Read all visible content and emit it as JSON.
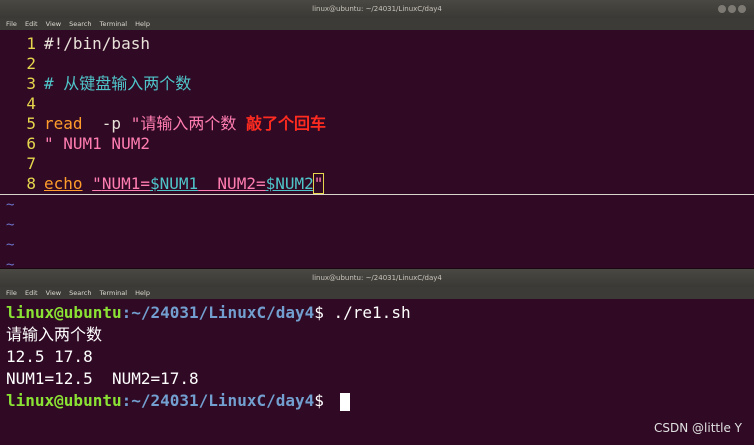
{
  "top": {
    "title": "linux@ubuntu: ~/24031/LinuxC/day4",
    "menu": [
      "File",
      "Edit",
      "View",
      "Search",
      "Terminal",
      "Help"
    ]
  },
  "bottom": {
    "title": "linux@ubuntu: ~/24031/LinuxC/day4",
    "menu": [
      "File",
      "Edit",
      "View",
      "Search",
      "Terminal",
      "Help"
    ]
  },
  "editor": {
    "line1": {
      "num": "1",
      "text": "#!/bin/bash"
    },
    "line2": {
      "num": "2"
    },
    "line3": {
      "num": "3",
      "text": "# 从键盘输入两个数"
    },
    "line4": {
      "num": "4"
    },
    "line5": {
      "num": "5",
      "cmd": "read",
      "opt": "  -p ",
      "str": "\"请输入两个数",
      "note": "敲了个回车"
    },
    "line6": {
      "num": "6",
      "text": "\" NUM1 NUM2"
    },
    "line7": {
      "num": "7"
    },
    "line8": {
      "num": "8",
      "cmd": "echo",
      "q1": "\"",
      "s1": "NUM1=",
      "v1": "$NUM1",
      "s2": "  NUM2=",
      "v2": "$NUM2",
      "q2": "\""
    },
    "tildes": [
      "~",
      "~",
      "~",
      "~"
    ]
  },
  "terminal": {
    "prompt_user": "linux@ubuntu",
    "prompt_path": ":~/24031/LinuxC/day4",
    "prompt_sym": "$ ",
    "command": "./re1.sh",
    "out1": "请输入两个数",
    "out2": "12.5 17.8",
    "out3": "NUM1=12.5  NUM2=17.8"
  },
  "watermark": "CSDN @little Y"
}
